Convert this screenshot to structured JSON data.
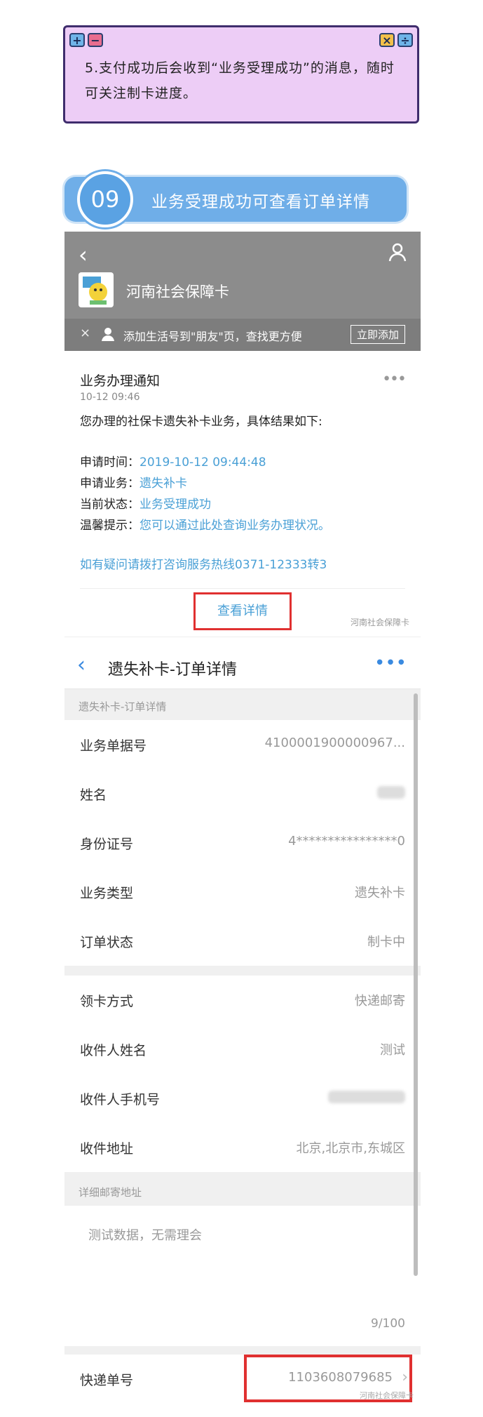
{
  "tip": {
    "text": "5.支付成功后会收到“业务受理成功”的消息，随时可关注制卡进度。",
    "plus": "+",
    "minus": "−",
    "close": "×",
    "divide": "÷"
  },
  "step": {
    "number": "09",
    "label": "业务受理成功可查看订单详情"
  },
  "wechat": {
    "back": "‹",
    "account_name": "河南社会保障卡",
    "follow_bar": {
      "close": "×",
      "text": "添加生活号到\"朋友\"页，查找更方便",
      "button": "立即添加"
    }
  },
  "notice": {
    "title": "业务办理通知",
    "time": "10-12 09:46",
    "more": "•••",
    "intro": "您办理的社保卡遗失补卡业务，具体结果如下:",
    "rows": [
      {
        "key": "申请时间：",
        "value": "2019-10-12  09:44:48"
      },
      {
        "key": "申请业务：",
        "value": "遗失补卡"
      },
      {
        "key": "当前状态：",
        "value": "业务受理成功"
      },
      {
        "key": "温馨提示：",
        "value": "您可以通过此处查询业务办理状况。"
      }
    ],
    "hotline": "如有疑问请拨打咨询服务热线0371-12333转3",
    "detail_button": "查看详情",
    "watermark": "河南社会保障卡"
  },
  "order": {
    "back": "‹",
    "title": "遗失补卡-订单详情",
    "more": "•••",
    "section1": "遗失补卡-订单详情",
    "fields1": [
      {
        "key": "业务单据号",
        "value": "4100001900000967..."
      },
      {
        "key": "姓名",
        "value": ""
      },
      {
        "key": "身份证号",
        "value": "4****************0"
      },
      {
        "key": "业务类型",
        "value": "遗失补卡"
      },
      {
        "key": "订单状态",
        "value": "制卡中"
      }
    ],
    "fields2": [
      {
        "key": "领卡方式",
        "value": "快递邮寄"
      },
      {
        "key": "收件人姓名",
        "value": "测试"
      },
      {
        "key": "收件人手机号",
        "value": ""
      },
      {
        "key": "收件地址",
        "value": "北京,北京市,东城区"
      }
    ],
    "section2": "详细邮寄地址",
    "address_text": "测试数据，无需理会",
    "address_count": "9/100",
    "express": {
      "key": "快递单号",
      "value": "1103608079685",
      "chevron": "›"
    },
    "watermark": "河南社会保障卡"
  }
}
